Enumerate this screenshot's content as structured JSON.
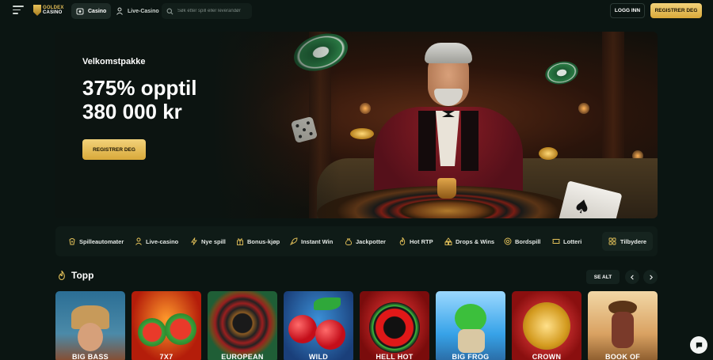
{
  "brand": {
    "line1": "GOLDEX",
    "line2": "CASINO"
  },
  "nav": {
    "tabs": [
      {
        "label": "Casino",
        "icon": "casino-icon",
        "active": true
      },
      {
        "label": "Live-Casino",
        "icon": "live-dealer-icon",
        "active": false
      }
    ],
    "search_placeholder": "Søk etter spill eller leverandør",
    "login_label": "LOGG INN",
    "register_label": "REGISTRER DEG"
  },
  "hero": {
    "eyebrow": "Velkomstpakke",
    "headline_line1": "375% opptil",
    "headline_line2": "380 000 kr",
    "cta_label": "REGISTRER DEG"
  },
  "categories": [
    {
      "label": "Spilleautomater",
      "icon": "slot-icon"
    },
    {
      "label": "Live-casino",
      "icon": "dealer-icon"
    },
    {
      "label": "Nye spill",
      "icon": "lightning-icon"
    },
    {
      "label": "Bonus-kjøp",
      "icon": "gift-icon"
    },
    {
      "label": "Instant Win",
      "icon": "rocket-icon"
    },
    {
      "label": "Jackpotter",
      "icon": "money-bag-icon"
    },
    {
      "label": "Hot RTP",
      "icon": "flame-icon"
    },
    {
      "label": "Drops & Wins",
      "icon": "drops-icon"
    },
    {
      "label": "Bordspill",
      "icon": "chip-icon"
    },
    {
      "label": "Lotteri",
      "icon": "ticket-icon"
    }
  ],
  "providers_label": "Tilbydere",
  "top_section": {
    "title": "Topp",
    "see_all_label": "SE ALT"
  },
  "games": [
    {
      "title": "BIG BASS"
    },
    {
      "title": "7X7"
    },
    {
      "title": "EUROPEAN"
    },
    {
      "title": "WILD"
    },
    {
      "title": "HELL HOT"
    },
    {
      "title": "BIG FROG"
    },
    {
      "title": "CROWN"
    },
    {
      "title": "BOOK OF"
    }
  ],
  "colors": {
    "accent_gold": "#e8bf56",
    "background": "#0b1512",
    "panel": "#0f1b17"
  }
}
